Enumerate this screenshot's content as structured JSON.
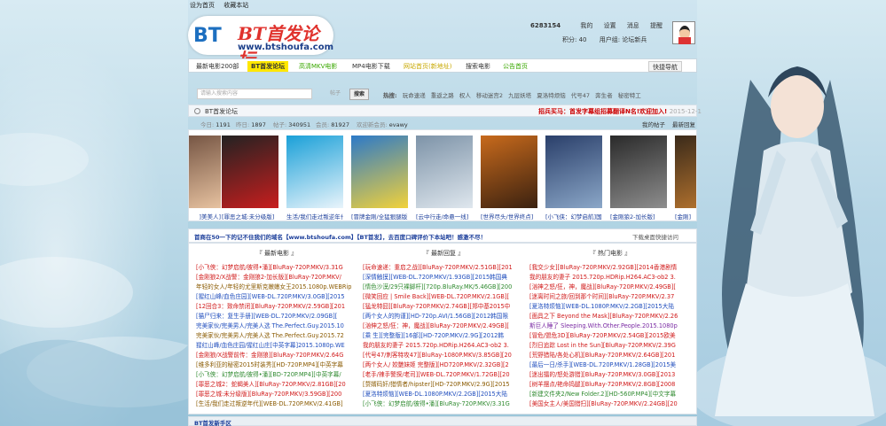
{
  "toplinks": [
    "设为首页",
    "收藏本站"
  ],
  "logo": {
    "bt": "BT",
    "name": "BT首发论坛",
    "url": "www.btshoufa.com"
  },
  "user": {
    "id": "6283154",
    "links": [
      "我的",
      "设置",
      "消息",
      "提醒",
      "退出"
    ],
    "points": "积分: 40",
    "group": "用户组: 论坛新兵"
  },
  "nav": {
    "tabs": [
      "最新电影200部",
      "BT首发论坛",
      "高清MKV电影",
      "MP4电影下载",
      "网站首页(新地址)",
      "搜索电影",
      "公告首页"
    ],
    "quick": "快捷导航"
  },
  "search": {
    "placeholder": "请输入搜索内容",
    "scope": "帖子",
    "button": "搜索",
    "hot_label": "热搜:",
    "hot": [
      "玩命速递",
      "重返之路",
      "权人",
      "移动迷宫2",
      "九层妖塔",
      "夏洛特烦恼",
      "代号47",
      "奔生者",
      "秘密特工"
    ]
  },
  "crumb": {
    "title": "BT首发论坛",
    "notice": "招兵买马：首发字幕组招募翻译N名!欢迎加入!",
    "date": "2015-12-1"
  },
  "stats": {
    "today_label": "今日:",
    "today": "1191",
    "yesterday_label": "昨日:",
    "yesterday": "1897",
    "posts_label": "帖子:",
    "posts": "340951",
    "members_label": "会员:",
    "members": "81927",
    "newest_label": "欢迎新会员:",
    "newest": "evawy",
    "my_posts": "我的帖子",
    "latest": "最新回复"
  },
  "movies": [
    {
      "caption": "]美美人]",
      "c1": "#6a4a3a",
      "c2": "#e7c2a0"
    },
    {
      "caption": "[罪恶之城:未分级版]",
      "c1": "#222222",
      "c2": "#c81e1e"
    },
    {
      "caption": "生活/我们走过叛逆年代",
      "c1": "#1aa0d8",
      "c2": "#e9f4fb"
    },
    {
      "caption": "[冒牌金刚/全猛狠腿版]",
      "c1": "#2c79c8",
      "c2": "#f2d23a"
    },
    {
      "caption": "[云中行走/命悬一线]",
      "c1": "#7d93a8",
      "c2": "#dfe7ee"
    },
    {
      "caption": "[世界尽头/世界终点]",
      "c1": "#c86a1c",
      "c2": "#3a2110"
    },
    {
      "caption": "[小飞侠：幻梦启航]国语",
      "c1": "#2a3f6a",
      "c2": "#8ba7c8"
    },
    {
      "caption": "[金刚狼2-加长版]",
      "c1": "#2a2a2a",
      "c2": "#8e8e8e"
    },
    {
      "caption": "[金刚]",
      "c1": "#3a2a1a",
      "c2": "#c07a30"
    }
  ],
  "notice_bar": {
    "text": "首商在50一下的记不住我们的域名【www.btshoufa.com】【BT首发】，去百度口碑评价下本站吧！感激不尽！",
    "right": "下载桌面快捷访问"
  },
  "columns": [
    {
      "title": "『 最新电影 』",
      "items": [
        {
          "t": "[小飞侠：幻梦启航/彼得•潘][BluRay-720P.MKV/3.31G",
          "c": "c-red"
        },
        {
          "t": "[金刚狼2/X战警：金刚狼2-加长版][BluRay-720P.MKV/",
          "c": "c-red"
        },
        {
          "t": "年轻的女人/年轻的尤里斯克嫩嫩女王2015.1080p.WEBRip",
          "c": "c-brown"
        },
        {
          "t": "[猩红山峰/血色庄园][WEB-DL.720P.MKV/3.0GB][2015",
          "c": "c-blue"
        },
        {
          "t": "[12回合3：致命禁闭][BluRay-720P.MKV/2.59GB][201",
          "c": "c-red"
        },
        {
          "t": "[猫尸归来：复生手册][WEB-DL.720P.MKV/2.09GB][",
          "c": "c-blue"
        },
        {
          "t": "完美家伙/完美男人/完美人选 The.Perfect.Guy.2015.10",
          "c": "c-blue"
        },
        {
          "t": "完美家伙/完美男人/完美人选 The.Perfect.Guy.2015.72",
          "c": "c-brown"
        },
        {
          "t": "猩红山峰/血色庄园/猩红山庄[中英字幕]2015.1080p.WE",
          "c": "c-blue"
        },
        {
          "t": "[金刚狼/X战警前传：金刚狼][BluRay-720P.MKV/2.64G",
          "c": "c-red"
        },
        {
          "t": "[维多利亚的秘密2015时装秀][HD-720P.MP4][中英字幕",
          "c": "c-brown"
        },
        {
          "t": "[小飞侠：幻梦启航/彼得•潘][BD-720P.MP4][中英字幕/",
          "c": "c-green"
        },
        {
          "t": "[罪恶之城2：蛇蝎美人][BluRay-720P.MKV/2.81GB][20",
          "c": "c-red"
        },
        {
          "t": "[罪恶之城:未分级版][BluRay-720P.MKV/3.59GB][200",
          "c": "c-red"
        },
        {
          "t": "[生活/我们走过叛逆年代][WEB-DL.720P.MKV/2.41GB]",
          "c": "c-brown"
        }
      ]
    },
    {
      "title": "『 最新回复 』",
      "items": [
        {
          "t": "[玩命速递：重启之战][BluRay-720P.MKV/2.51GB][201",
          "c": "c-red"
        },
        {
          "t": "[深情触摸][WEB-DL.720P.MKV/1.93GB][2015韩国典",
          "c": "c-blue"
        },
        {
          "t": "[情色沙漠/29只裸脚杆][720p.BluRay.MK/5.46GB][200",
          "c": "c-green"
        },
        {
          "t": "[微笑回应 | Smile Back][WEB-DL.720P.MKV/2.1GB][",
          "c": "c-red"
        },
        {
          "t": "[猛龙特囧][BluRay-720P.MKV/2.74GB][郑中基2015中",
          "c": "c-red"
        },
        {
          "t": "[两个女人的拘谨][HD-720p.AVI/1.56GB][2012韩国限",
          "c": "c-blue"
        },
        {
          "t": "[汹伸之怒/狂：神，魔战][BluRay-720P.MKV/2.49GB][",
          "c": "c-red"
        },
        {
          "t": "[乘 生][完整版][16部][HD-720P.MKV/2.9G][2012韩",
          "c": "c-blue"
        },
        {
          "t": "我的朋友的妻子 2015.720p.HDRip.H264.AC3-ob2 3.",
          "c": "c-red"
        },
        {
          "t": "[代号47/刺客特攻47][BluRay-1080P.MKV/3.85GB][20",
          "c": "c-red"
        },
        {
          "t": "[两个女人/ 姣艷妹姬 完整版][HD720P.MKV/2.32GB][2",
          "c": "c-red"
        },
        {
          "t": "[老手/辣手警探/老司][WEB-DL.720P.MKV/1.72GB][20",
          "c": "c-red"
        },
        {
          "t": "[赘婿码奸/猎情者/hipster][HD-720P.MKV/2.9G][2015",
          "c": "c-brown"
        },
        {
          "t": "[夏洛特烦恼][WEB-DL.1080P.MKV/2.2GB][2015大陆",
          "c": "c-blue"
        },
        {
          "t": "[小飞侠：幻梦启航/彼得•潘][BluRay-720P.MKV/3.31G",
          "c": "c-green"
        }
      ]
    },
    {
      "title": "『 热门电影 』",
      "items": [
        {
          "t": "[我交少女][BluRay-720P.MKV/2.92GB][2014香港剧情",
          "c": "c-red"
        },
        {
          "t": "我的朋友的妻子 2015.720p.HDRip.H264.AC3-ob2 3.",
          "c": "c-red"
        },
        {
          "t": "[汹神之怒/狂，神，魔战][BluRay-720P.MKV/2.49GB][",
          "c": "c-red"
        },
        {
          "t": "[迷离时间之旅/回到那个时间][BluRay-720P.MKV/2.37",
          "c": "c-red"
        },
        {
          "t": "[夏洛特烦恼][WEB-DL.1080P.MKV/2.2GB][2015大陆",
          "c": "c-blue"
        },
        {
          "t": "[面具之下 Beyond the Mask][BluRay-720P.MKV/2.26",
          "c": "c-red"
        },
        {
          "t": "斯巨人睡了 Sleeping.With.Other.People.2015.1080p",
          "c": "c-purple"
        },
        {
          "t": "[冒危/盟危3D][BluRay-720P.MKV/2.54GB][2015欧美",
          "c": "c-red"
        },
        {
          "t": "[烈日追踪 Lost in the Sun][BluRay-720P.MKV/2.39G",
          "c": "c-red"
        },
        {
          "t": "[荒野猎陆/各处心机][BluRay-720P.MKV/2.64GB][201",
          "c": "c-red"
        },
        {
          "t": "[最后一日/杀手][WEB-DL.720P.MKV/1.28GB][2015美",
          "c": "c-blue"
        },
        {
          "t": "[迷出擂的/怒处游猎][BluRay-720P.MKV/3.0GB][2013",
          "c": "c-red"
        },
        {
          "t": "[树羊摆点/艳命捣腿][BluRay-720P.MKV/2.8GB][2008",
          "c": "c-red"
        },
        {
          "t": "[新建文件夹2/New Folder.2][HD-560P.MP4][中文字幕",
          "c": "c-green"
        },
        {
          "t": "[美国女主人/美国猎扫][BluRay-720P.MKV/2.24GB][20",
          "c": "c-red"
        }
      ]
    }
  ],
  "footer": {
    "title": "BT首发新手区"
  }
}
